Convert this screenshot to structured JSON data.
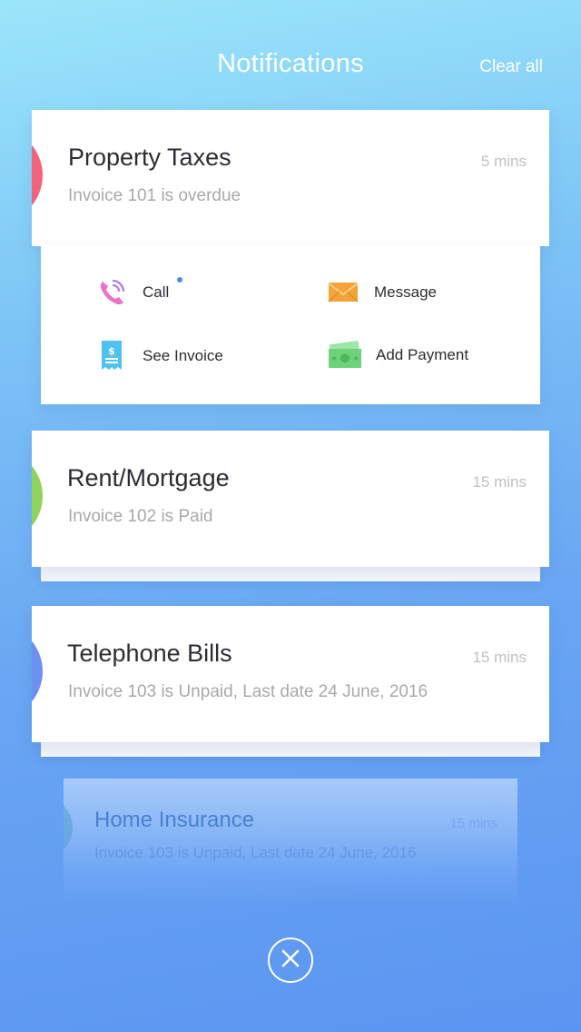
{
  "header": {
    "title": "Notifications",
    "clear_all_label": "Clear all"
  },
  "notifications": [
    {
      "title": "Property Taxes",
      "subtitle": "Invoice 101 is overdue",
      "time": "5 mins",
      "accent_color": "#f2637a"
    },
    {
      "title": "Rent/Mortgage",
      "subtitle": "Invoice 102 is Paid",
      "time": "15 mins",
      "accent_color": "#8fd35a"
    },
    {
      "title": "Telephone Bills",
      "subtitle": "Invoice 103 is Unpaid, Last date 24 June, 2016",
      "time": "15 mins",
      "accent_color": "#6c8ff0"
    },
    {
      "title": "Home Insurance",
      "subtitle": "Invoice 103 is Unpaid, Last date 24 June, 2016",
      "time": "15 mins",
      "accent_color": "#55a0d7"
    }
  ],
  "actions": {
    "call_label": "Call",
    "message_label": "Message",
    "see_invoice_label": "See Invoice",
    "add_payment_label": "Add Payment"
  },
  "icons": {
    "call": "phone-icon",
    "message": "envelope-icon",
    "invoice": "receipt-icon",
    "payment": "cash-icon",
    "close": "close-icon"
  },
  "colors": {
    "background_top": "#9be6fb",
    "background_bottom": "#5b95f2",
    "text_primary": "#2a2d35",
    "text_secondary": "#a8a9ae",
    "call_icon": "#e873c9",
    "message_icon": "#f2a33a",
    "invoice_icon": "#4ec3f0",
    "payment_icon": "#6ed27a"
  }
}
